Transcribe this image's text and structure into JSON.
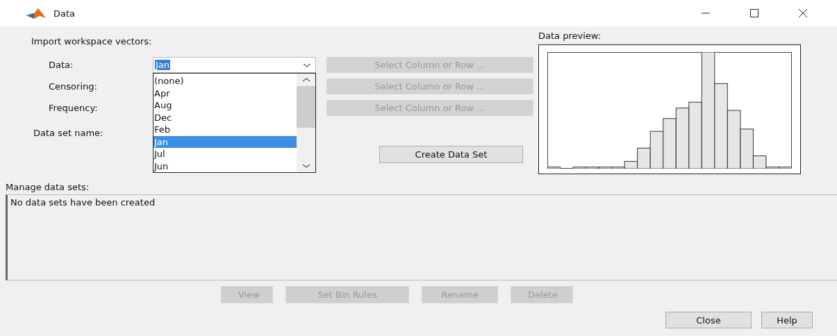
{
  "window": {
    "title": "Data"
  },
  "import": {
    "heading": "Import workspace vectors:",
    "rows": [
      {
        "label": "Data:",
        "button": {
          "label": "Select Column or Row ...",
          "disabled": true
        }
      },
      {
        "label": "Censoring:",
        "button": {
          "label": "Select Column or Row ...",
          "disabled": true
        }
      },
      {
        "label": "Frequency:",
        "button": {
          "label": "Select Column or Row ...",
          "disabled": true
        }
      }
    ],
    "data_combo": {
      "value": "Jan",
      "expanded": true,
      "options": [
        {
          "label": "(none)",
          "selected": false
        },
        {
          "label": "Apr",
          "selected": false
        },
        {
          "label": "Aug",
          "selected": false
        },
        {
          "label": "Dec",
          "selected": false
        },
        {
          "label": "Feb",
          "selected": false
        },
        {
          "label": "Jan",
          "selected": true
        },
        {
          "label": "Jul",
          "selected": false
        },
        {
          "label": "Jun",
          "selected": false
        }
      ]
    },
    "data_set_name_label": "Data set name:",
    "create_button": {
      "label": "Create Data Set",
      "disabled": false
    }
  },
  "preview": {
    "label": "Data preview:"
  },
  "manage": {
    "label": "Manage data sets:",
    "message": "No data sets have been created",
    "buttons": [
      {
        "label": "View",
        "disabled": true
      },
      {
        "label": "Set Bin Rules",
        "disabled": true
      },
      {
        "label": "Rename",
        "disabled": true
      },
      {
        "label": "Delete",
        "disabled": true
      }
    ]
  },
  "footer_buttons": [
    {
      "label": "Close",
      "disabled": false
    },
    {
      "label": "Help",
      "disabled": false
    }
  ]
}
